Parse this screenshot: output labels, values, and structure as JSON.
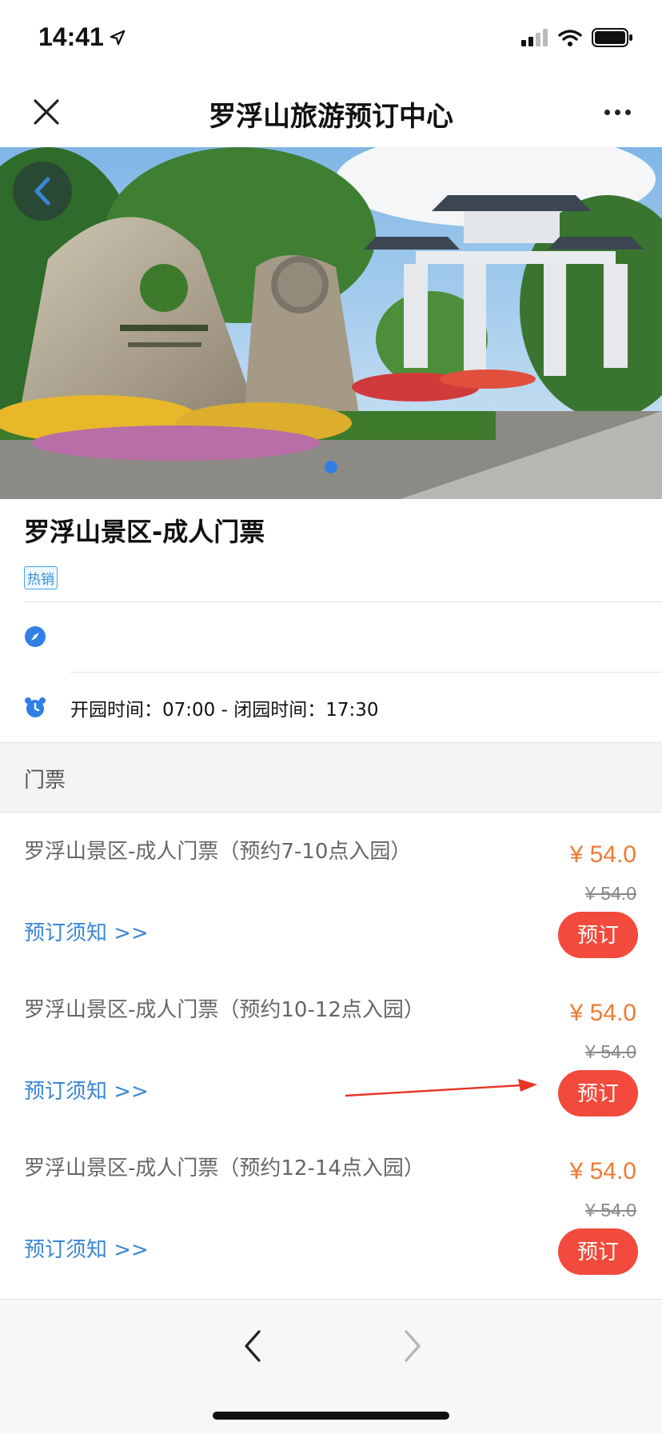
{
  "status_bar": {
    "time": "14:41"
  },
  "nav": {
    "title": "罗浮山旅游预订中心"
  },
  "product": {
    "title": "罗浮山景区-成人门票",
    "badge": "热销",
    "hours": "开园时间：07:00 - 闭园时间：17:30"
  },
  "section": {
    "label": "门票"
  },
  "tickets": [
    {
      "name": "罗浮山景区-成人门票（预约7-10点入园）",
      "price": "¥ 54.0",
      "original_price": "¥ 54.0",
      "notice": "预订须知 >>",
      "book": "预订"
    },
    {
      "name": "罗浮山景区-成人门票（预约10-12点入园）",
      "price": "¥ 54.0",
      "original_price": "¥ 54.0",
      "notice": "预订须知 >>",
      "book": "预订"
    },
    {
      "name": "罗浮山景区-成人门票（预约12-14点入园）",
      "price": "¥ 54.0",
      "original_price": "¥ 54.0",
      "notice": "预订须知 >>",
      "book": "预订"
    }
  ],
  "colors": {
    "price": "#f07a32",
    "button": "#f24a3c",
    "link": "#3a86d4",
    "accent": "#2f7fe5"
  },
  "icons": [
    "location-arrow-icon",
    "signal-icon",
    "wifi-icon",
    "battery-icon",
    "close-icon",
    "more-icon",
    "back-chevron-icon",
    "compass-icon",
    "alarm-clock-icon",
    "browser-back-icon",
    "browser-forward-icon"
  ]
}
